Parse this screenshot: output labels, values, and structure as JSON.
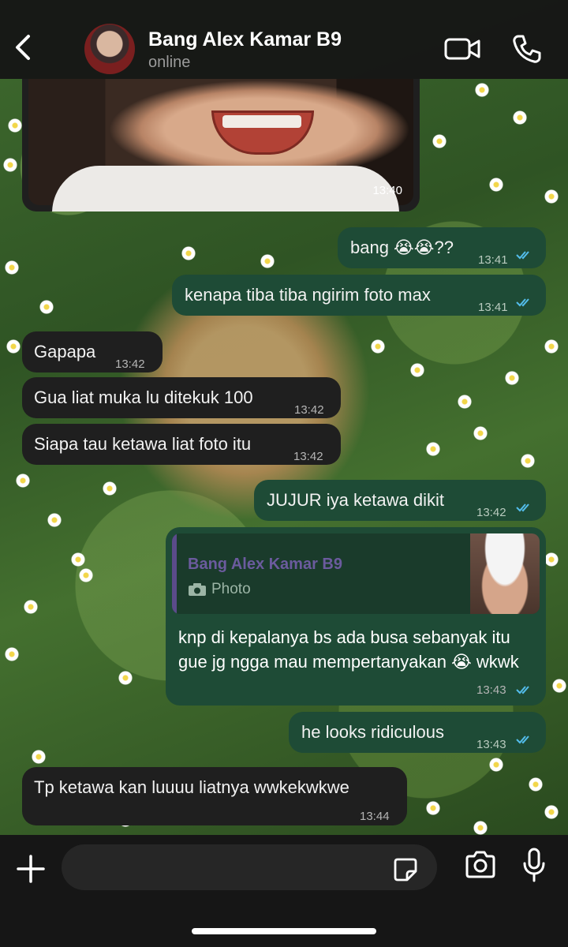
{
  "header": {
    "contact_name": "Bang Alex Kamar B9",
    "status": "online"
  },
  "photo_message": {
    "time": "13:40"
  },
  "messages": [
    {
      "direction": "out",
      "text": "bang 😭😭??",
      "time": "13:41",
      "read": true
    },
    {
      "direction": "out",
      "text": "kenapa tiba tiba ngirim foto max",
      "time": "13:41",
      "read": true
    },
    {
      "direction": "in",
      "text": "Gapapa",
      "time": "13:42"
    },
    {
      "direction": "in",
      "text": "Gua liat muka lu ditekuk 100",
      "time": "13:42"
    },
    {
      "direction": "in",
      "text": "Siapa tau ketawa liat foto itu",
      "time": "13:42"
    },
    {
      "direction": "out",
      "text": "JUJUR iya ketawa dikit",
      "time": "13:42",
      "read": true
    },
    {
      "direction": "out",
      "text": "he looks ridiculous",
      "time": "13:43",
      "read": true
    },
    {
      "direction": "in",
      "text": "Tp ketawa kan luuuu liatnya wwkekwkwe",
      "time": "13:44"
    }
  ],
  "reply_message": {
    "quoted_name": "Bang Alex Kamar B9",
    "quoted_label": "Photo",
    "text": "knp di kepalanya bs ada busa sebanyak itu gue jg ngga mau mempertanyakan 😭 wkwk",
    "time": "13:43",
    "read": true
  },
  "composer": {
    "placeholder": ""
  },
  "icons": [
    "back-chevron-icon",
    "video-call-icon",
    "phone-icon",
    "plus-icon",
    "sticker-icon",
    "camera-icon",
    "microphone-icon",
    "read-receipt-icon"
  ],
  "colors": {
    "outgoing_bubble": "#1e4b36",
    "incoming_bubble": "#1f1f1f",
    "read_tick": "#53bdeb"
  }
}
